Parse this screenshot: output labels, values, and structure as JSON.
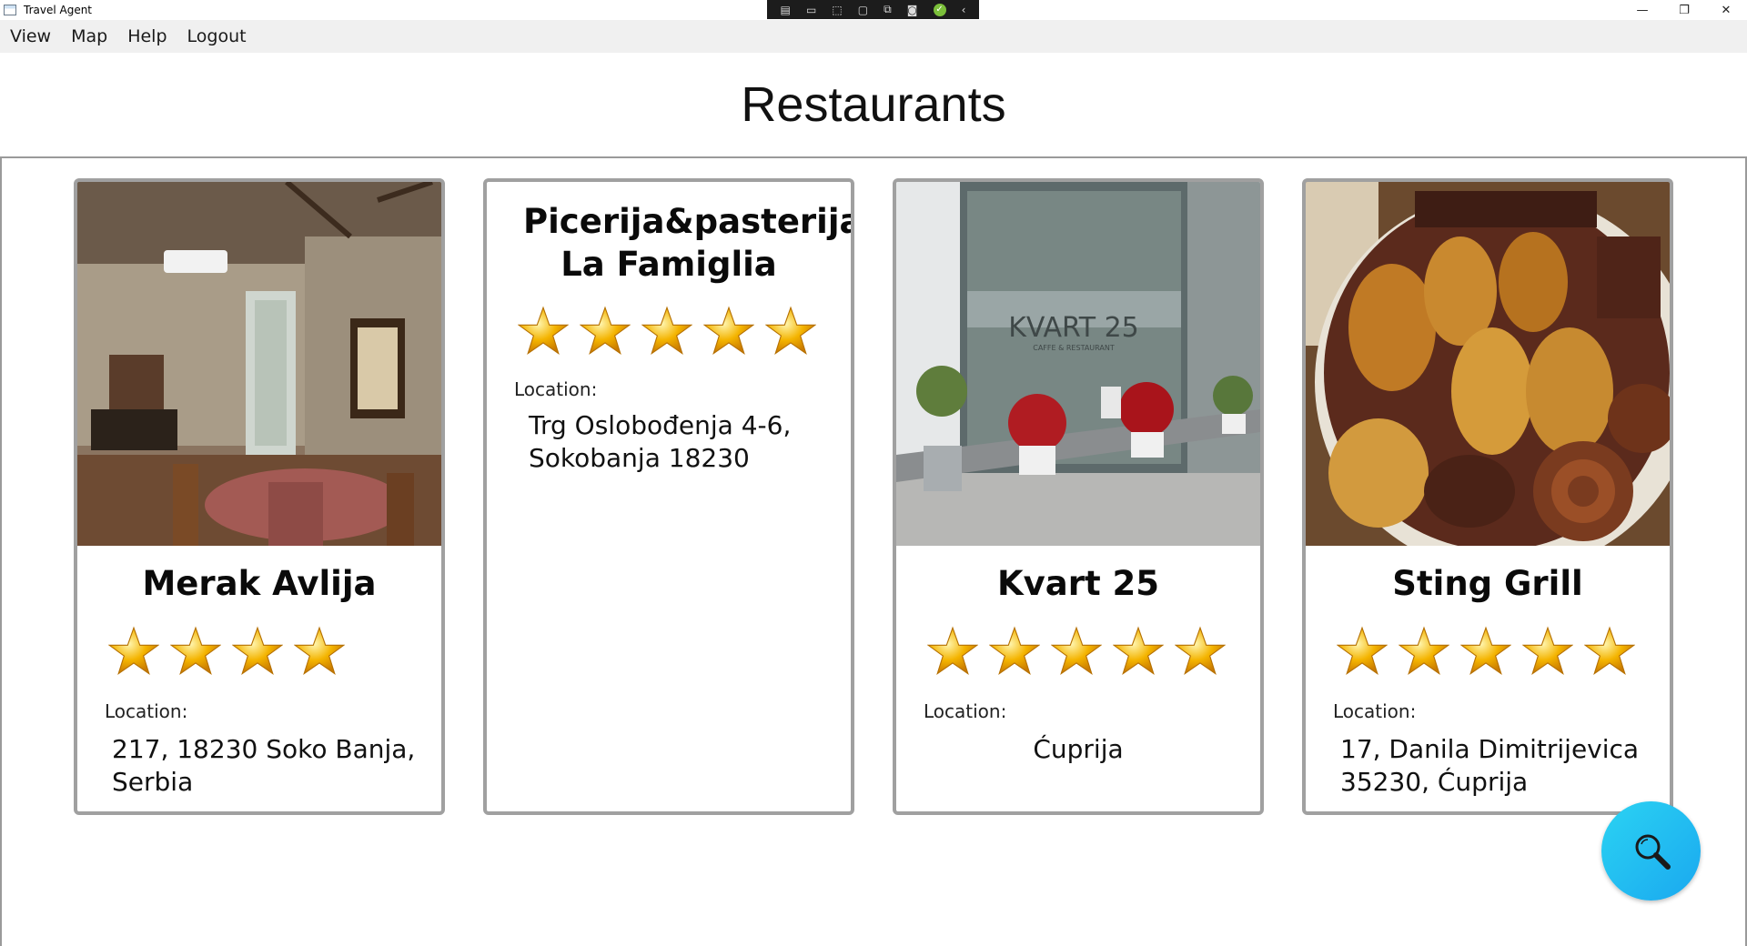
{
  "window": {
    "title": "Travel Agent"
  },
  "menu": {
    "items": [
      "View",
      "Map",
      "Help",
      "Logout"
    ]
  },
  "page": {
    "title": "Restaurants"
  },
  "restaurants": [
    {
      "name": "Merak Avlija",
      "rating": 4,
      "location_label": "Location:",
      "location": "217, 18230 Soko Banja, Serbia",
      "photo": "restaurant-interior-photo"
    },
    {
      "name": "Picerija&pasterija La Famiglia",
      "rating": 5,
      "location_label": "Location:",
      "location": "Trg Oslobođenja 4-6, Sokobanja 18230",
      "photo": null
    },
    {
      "name": "Kvart 25",
      "rating": 5,
      "location_label": "Location:",
      "location": "Ćuprija",
      "photo": "storefront-photo",
      "sign_text": "KVART 25",
      "sign_sub": "CAFFE & RESTAURANT"
    },
    {
      "name": "Sting Grill",
      "rating": 5,
      "location_label": "Location:",
      "location": "17, Danila Dimitrijevica 35230, Ćuprija",
      "photo": "grilled-meat-platter-photo"
    }
  ],
  "colors": {
    "card_border": "#a0a0a0",
    "star": "#f4b400",
    "fab_gradient_start": "#2bd3f2",
    "fab_gradient_end": "#1aa8f0"
  },
  "icons": {
    "fab": "search-icon",
    "window_minimize": "minimize-icon",
    "window_restore": "restore-icon",
    "window_close": "close-icon"
  }
}
